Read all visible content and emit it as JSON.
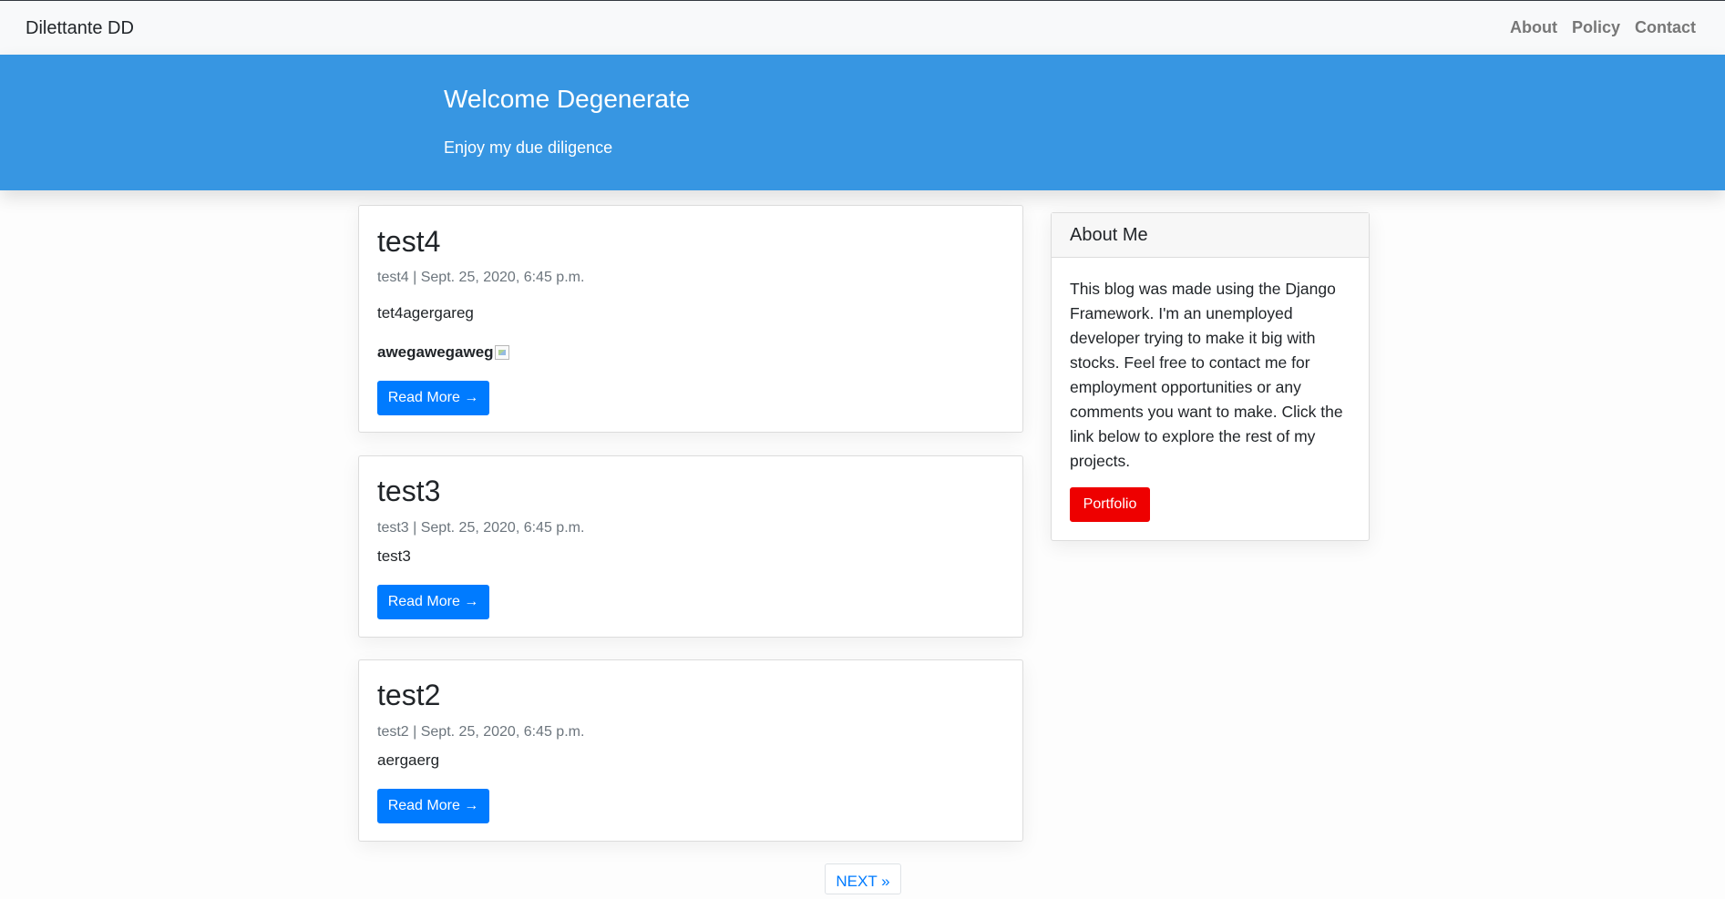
{
  "navbar": {
    "brand": "Dilettante DD",
    "links": [
      "About",
      "Policy",
      "Contact"
    ]
  },
  "masthead": {
    "title": "Welcome Degenerate",
    "subtitle": "Enjoy my due diligence"
  },
  "posts": [
    {
      "title": "test4",
      "meta": "test4 | Sept. 25, 2020, 6:45 p.m.",
      "body": "tet4agergareg",
      "bold": "awegawegaweg",
      "button": "Read More →"
    },
    {
      "title": "test3",
      "meta": "test3 | Sept. 25, 2020, 6:45 p.m.",
      "body": "test3",
      "button": "Read More →"
    },
    {
      "title": "test2",
      "meta": "test2 | Sept. 25, 2020, 6:45 p.m.",
      "body": "aergaerg",
      "button": "Read More →"
    }
  ],
  "sidebar": {
    "title": "About Me",
    "text": "This blog was made using the Django Framework. I'm an unemployed developer trying to make it big with stocks. Feel free to contact me for employment opportunities or any comments you want to make. Click the link below to explore the rest of my projects.",
    "button": "Portfolio"
  },
  "pagination": {
    "next": "NEXT »"
  },
  "colors": {
    "masthead": "#3796e2",
    "primary": "#007bff",
    "portfolio": "#ee0000"
  },
  "icons": {
    "broken_image": "broken-image-icon"
  }
}
